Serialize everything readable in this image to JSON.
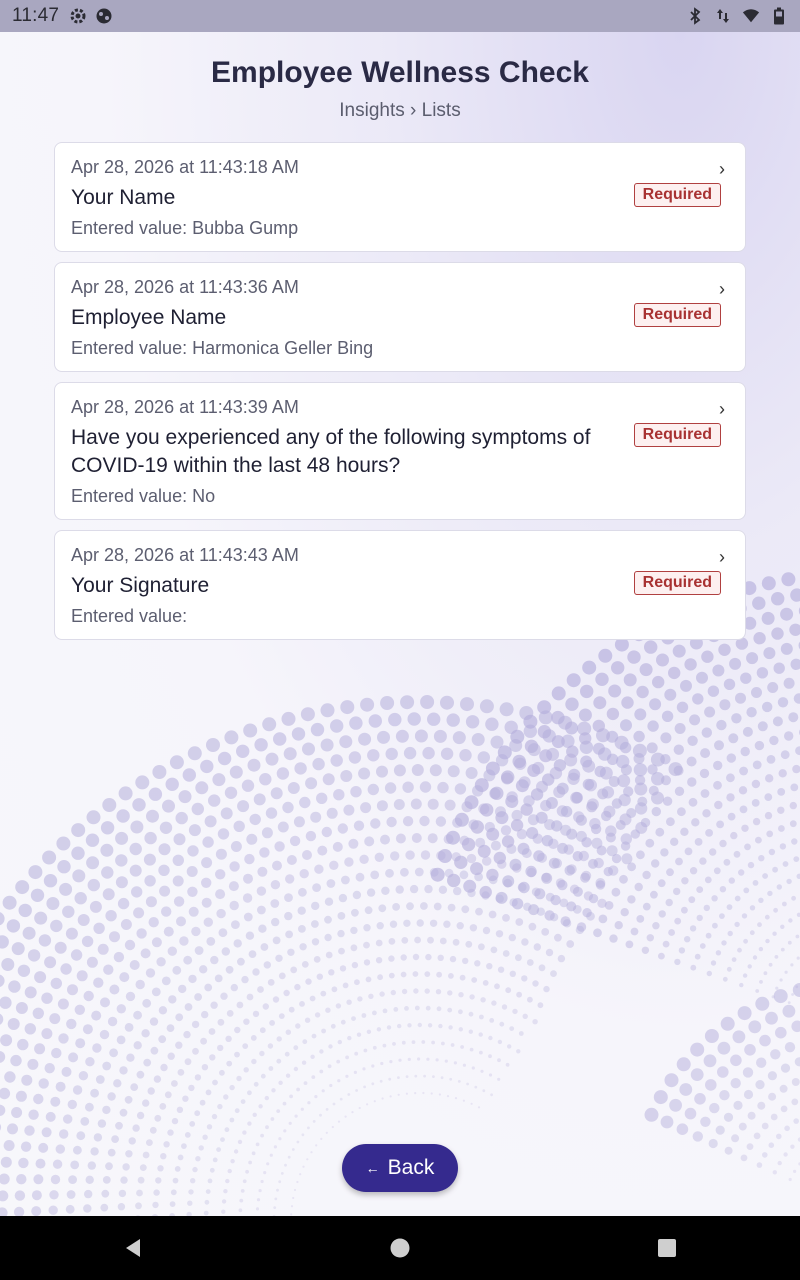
{
  "status_bar": {
    "time": "11:47",
    "left_icons": [
      "settings-icon",
      "globe-icon"
    ],
    "right_icons": [
      "bluetooth-icon",
      "data-arrows-icon",
      "wifi-icon",
      "battery-icon"
    ]
  },
  "header": {
    "title": "Employee Wellness Check",
    "breadcrumb": {
      "item1": "Insights",
      "separator": "›",
      "item2": "Lists"
    }
  },
  "entries": [
    {
      "timestamp": "Apr 28, 2026 at 11:43:18 AM",
      "title": "Your Name",
      "value": "Entered value: Bubba Gump",
      "badge": "Required",
      "chevron": "›"
    },
    {
      "timestamp": "Apr 28, 2026 at 11:43:36 AM",
      "title": "Employee Name",
      "value": "Entered value: Harmonica Geller Bing",
      "badge": "Required",
      "chevron": "›"
    },
    {
      "timestamp": "Apr 28, 2026 at 11:43:39 AM",
      "title": "Have you experienced any of the following symptoms of COVID-19 within the last 48 hours?",
      "value": "Entered value: No",
      "badge": "Required",
      "chevron": "›"
    },
    {
      "timestamp": "Apr 28, 2026 at 11:43:43 AM",
      "title": "Your Signature",
      "value": "Entered value:",
      "badge": "Required",
      "chevron": "›"
    }
  ],
  "footer": {
    "back_label": "Back",
    "back_arrow": "←"
  },
  "colors": {
    "accent": "#352a8e",
    "required_badge": "#a83232",
    "dots": "#b4aedb"
  },
  "nav_bar": {
    "buttons": [
      "back-triangle-icon",
      "home-circle-icon",
      "recents-square-icon"
    ]
  }
}
